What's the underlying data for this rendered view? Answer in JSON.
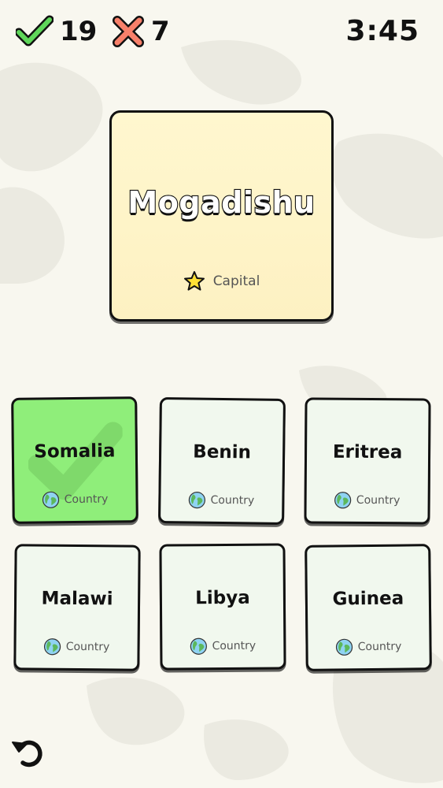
{
  "score": {
    "correct_count": "19",
    "wrong_count": "7",
    "correct_icon": "check-mark-icon",
    "wrong_icon": "cross-mark-icon"
  },
  "timer": "3:45",
  "prompt": {
    "word": "Mogadishu",
    "type_label": "Capital",
    "type_icon": "star-icon"
  },
  "answers": [
    {
      "name": "Somalia",
      "type_label": "Country",
      "state": "correct"
    },
    {
      "name": "Benin",
      "type_label": "Country",
      "state": "default"
    },
    {
      "name": "Eritrea",
      "type_label": "Country",
      "state": "default"
    },
    {
      "name": "Malawi",
      "type_label": "Country",
      "state": "default"
    },
    {
      "name": "Libya",
      "type_label": "Country",
      "state": "default"
    },
    {
      "name": "Guinea",
      "type_label": "Country",
      "state": "default"
    }
  ],
  "icons": {
    "answer_type_icon": "globe-icon",
    "undo": "undo-icon"
  },
  "colors": {
    "background": "#f8f7ef",
    "prompt_card": "#fff7cf",
    "answer_card": "#f1f8ee",
    "correct_card": "#8fee7a",
    "correct_mark": "#5fd65a",
    "wrong_mark": "#f7806a",
    "star": "#ffe135"
  }
}
